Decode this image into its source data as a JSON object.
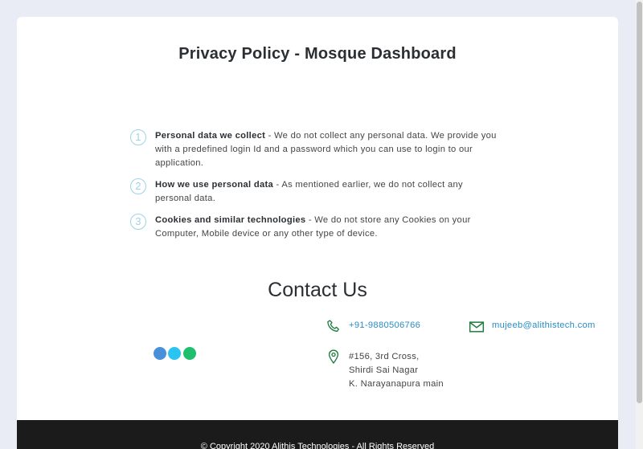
{
  "page": {
    "title": "Privacy Policy - Mosque Dashboard"
  },
  "policy": {
    "items": [
      {
        "number": "1",
        "heading": "Personal data we collect",
        "text": " - We do not collect any personal data. We provide you with a predefined login Id and a password which you can use to login to our application."
      },
      {
        "number": "2",
        "heading": "How we use personal data",
        "text": " - As mentioned earlier, we do not collect any personal data."
      },
      {
        "number": "3",
        "heading": "Cookies and similar technologies",
        "text": " - We do not store any Cookies on your Computer, Mobile device or any other type of device."
      }
    ]
  },
  "contact": {
    "title": "Contact Us",
    "phone": "+91-9880506766",
    "email": "mujeeb@alithistech.com",
    "address": [
      "#156, 3rd Cross,",
      "Shirdi Sai Nagar",
      "K. Narayanapura main"
    ],
    "icon_color": "#1e7b3e",
    "link_color": "#2a8cc4",
    "dot_colors": [
      "#4a90d9",
      "#29c4f0",
      "#1fbf6e"
    ]
  },
  "footer": {
    "copyright": "© Copyright 2020 Alithis Technologies - All Rights Reserved"
  }
}
